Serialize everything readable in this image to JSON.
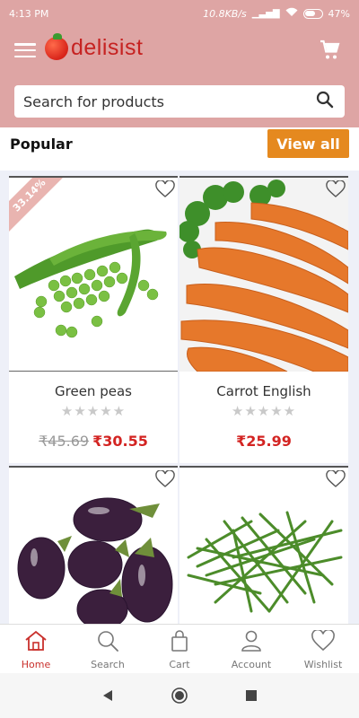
{
  "status": {
    "time": "4:13 PM",
    "speed": "10.8KB/s",
    "battery": "47%"
  },
  "brand": {
    "name": "delisist",
    "color": "#c62221"
  },
  "search": {
    "placeholder": "Search for products"
  },
  "section": {
    "title": "Popular",
    "view_all": "View all"
  },
  "products": [
    {
      "name": "Green peas",
      "old_price": "₹45.69",
      "price": "₹30.55",
      "discount": "33.14%",
      "stars": "★★★★★"
    },
    {
      "name": "Carrot English",
      "old_price": "",
      "price": "₹25.99",
      "discount": "",
      "stars": "★★★★★"
    },
    {
      "name": "",
      "old_price": "",
      "price": "",
      "discount": "",
      "stars": ""
    },
    {
      "name": "",
      "old_price": "",
      "price": "",
      "discount": "",
      "stars": ""
    }
  ],
  "nav": [
    {
      "label": "Home",
      "icon": "home-icon",
      "active": true
    },
    {
      "label": "Search",
      "icon": "search-icon",
      "active": false
    },
    {
      "label": "Cart",
      "icon": "bag-icon",
      "active": false
    },
    {
      "label": "Account",
      "icon": "account-icon",
      "active": false
    },
    {
      "label": "Wishlist",
      "icon": "heart-icon",
      "active": false
    }
  ],
  "colors": {
    "header": "#dea5a4",
    "accent": "#e5891f",
    "price": "#d32422"
  }
}
